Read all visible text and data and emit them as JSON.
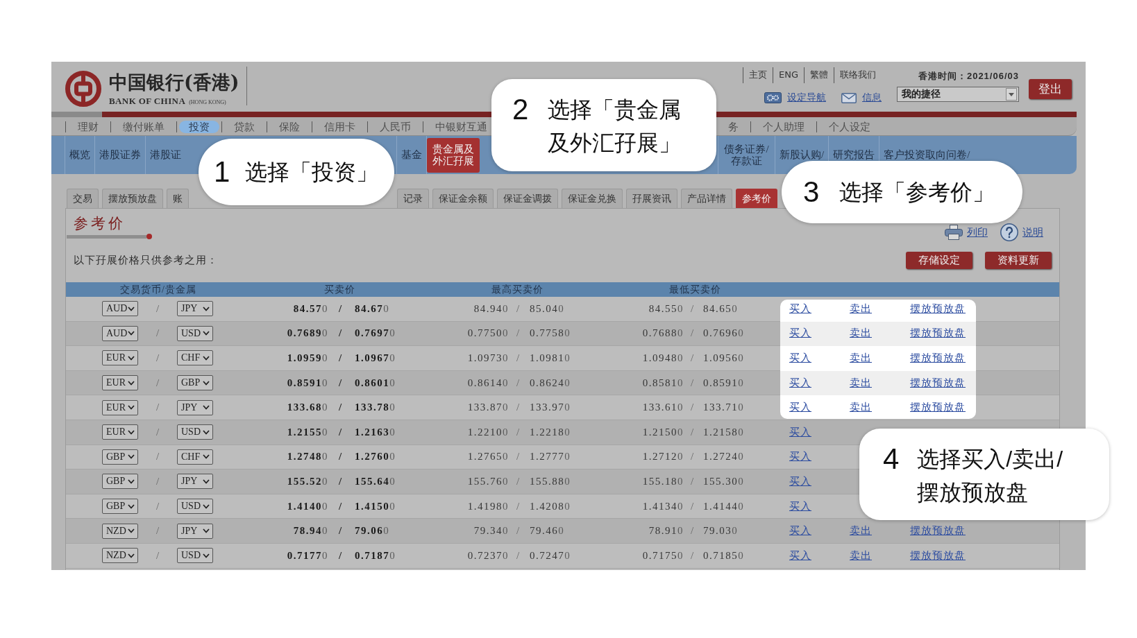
{
  "header": {
    "logo": {
      "name_zh": "中国银行(香港)",
      "name_en": "BANK OF CHINA",
      "region_en": "(HONG KONG)"
    },
    "top_links": [
      "主页",
      "ENG",
      "繁體",
      "联络我们"
    ],
    "time": "香港时间：2021/06/03",
    "logout_button": "登出",
    "tools": [
      {
        "kind": "settings",
        "label": "设定导航"
      },
      {
        "kind": "mail",
        "label": "信息"
      }
    ],
    "shortcut_dropdown": {
      "value": "我的捷径"
    }
  },
  "main_nav": [
    {
      "label": "理财",
      "selected": false
    },
    {
      "label": "缴付账单",
      "selected": false
    },
    {
      "label": "投资",
      "selected": true
    },
    {
      "label": "贷款",
      "selected": false
    },
    {
      "label": "保险",
      "selected": false
    },
    {
      "label": "信用卡",
      "selected": false
    },
    {
      "label": "人民币",
      "selected": false
    },
    {
      "label": "中银财互通",
      "selected": false
    },
    {
      "label": "务",
      "selected": false
    },
    {
      "label": "个人助理",
      "selected": false
    },
    {
      "label": "个人设定",
      "selected": false
    }
  ],
  "sub_nav": [
    {
      "label": "概览",
      "selected": false
    },
    {
      "label": "港股证券",
      "selected": false
    },
    {
      "label": "港股证",
      "selected": false
    },
    {
      "label": "基金",
      "selected": false
    },
    {
      "label": "贵金属及外汇孖展",
      "selected": true
    },
    {
      "label": "债务证券/存款证",
      "selected": false
    },
    {
      "label": "新股认购/",
      "selected": false
    },
    {
      "label": "研究报告",
      "selected": false
    },
    {
      "label": "客户投资取向问卷/",
      "selected": false
    }
  ],
  "tabs": [
    {
      "label": "交易",
      "selected": false
    },
    {
      "label": "摆放预放盘",
      "selected": false
    },
    {
      "label": "账",
      "selected": false
    },
    {
      "label": "记录",
      "selected": false
    },
    {
      "label": "保证金余额",
      "selected": false
    },
    {
      "label": "保证金调拨",
      "selected": false
    },
    {
      "label": "保证金兑换",
      "selected": false
    },
    {
      "label": "孖展资讯",
      "selected": false
    },
    {
      "label": "产品详情",
      "selected": false
    },
    {
      "label": "参考价",
      "selected": true
    }
  ],
  "content": {
    "title": "参考价",
    "note": "以下孖展价格只供参考之用：",
    "links": [
      {
        "kind": "print",
        "label": "列印"
      },
      {
        "kind": "help",
        "label": "说明"
      }
    ],
    "buttons": [
      "存储设定",
      "资料更新"
    ]
  },
  "table": {
    "columns": [
      "交易货币/贵金属",
      "买卖价",
      "最高买卖价",
      "最低买卖价"
    ],
    "rows": [
      {
        "pair": {
          "base": "AUD",
          "separator": "/",
          "quote": "JPY"
        },
        "bid_ask": {
          "bid": "84.570",
          "separator": "/",
          "ask": "84.670"
        },
        "high": {
          "bid": "84.940",
          "separator": "/",
          "ask": "85.040"
        },
        "low": {
          "bid": "84.550",
          "separator": "/",
          "ask": "84.650"
        },
        "actions": [
          "买入",
          "卖出",
          "摆放预放盘"
        ],
        "highlighted": true
      },
      {
        "pair": {
          "base": "AUD",
          "separator": "/",
          "quote": "USD"
        },
        "bid_ask": {
          "bid": "0.76890",
          "separator": "/",
          "ask": "0.76970"
        },
        "high": {
          "bid": "0.77500",
          "separator": "/",
          "ask": "0.77580"
        },
        "low": {
          "bid": "0.76880",
          "separator": "/",
          "ask": "0.76960"
        },
        "actions": [
          "买入",
          "卖出",
          "摆放预放盘"
        ],
        "highlighted": true
      },
      {
        "pair": {
          "base": "EUR",
          "separator": "/",
          "quote": "CHF"
        },
        "bid_ask": {
          "bid": "1.09590",
          "separator": "/",
          "ask": "1.09670"
        },
        "high": {
          "bid": "1.09730",
          "separator": "/",
          "ask": "1.09810"
        },
        "low": {
          "bid": "1.09480",
          "separator": "/",
          "ask": "1.09560"
        },
        "actions": [
          "买入",
          "卖出",
          "摆放预放盘"
        ],
        "highlighted": true
      },
      {
        "pair": {
          "base": "EUR",
          "separator": "/",
          "quote": "GBP"
        },
        "bid_ask": {
          "bid": "0.85910",
          "separator": "/",
          "ask": "0.86010"
        },
        "high": {
          "bid": "0.86140",
          "separator": "/",
          "ask": "0.86240"
        },
        "low": {
          "bid": "0.85810",
          "separator": "/",
          "ask": "0.85910"
        },
        "actions": [
          "买入",
          "卖出",
          "摆放预放盘"
        ],
        "highlighted": true
      },
      {
        "pair": {
          "base": "EUR",
          "separator": "/",
          "quote": "JPY"
        },
        "bid_ask": {
          "bid": "133.680",
          "separator": "/",
          "ask": "133.780"
        },
        "high": {
          "bid": "133.870",
          "separator": "/",
          "ask": "133.970"
        },
        "low": {
          "bid": "133.610",
          "separator": "/",
          "ask": "133.710"
        },
        "actions": [
          "买入",
          "卖出",
          "摆放预放盘"
        ],
        "highlighted": true
      },
      {
        "pair": {
          "base": "EUR",
          "separator": "/",
          "quote": "USD"
        },
        "bid_ask": {
          "bid": "1.21550",
          "separator": "/",
          "ask": "1.21630"
        },
        "high": {
          "bid": "1.22100",
          "separator": "/",
          "ask": "1.22180"
        },
        "low": {
          "bid": "1.21500",
          "separator": "/",
          "ask": "1.21580"
        },
        "actions": [
          "买入"
        ],
        "highlighted": false
      },
      {
        "pair": {
          "base": "GBP",
          "separator": "/",
          "quote": "CHF"
        },
        "bid_ask": {
          "bid": "1.27480",
          "separator": "/",
          "ask": "1.27600"
        },
        "high": {
          "bid": "1.27650",
          "separator": "/",
          "ask": "1.27770"
        },
        "low": {
          "bid": "1.27120",
          "separator": "/",
          "ask": "1.27240"
        },
        "actions": [
          "买入"
        ],
        "highlighted": false
      },
      {
        "pair": {
          "base": "GBP",
          "separator": "/",
          "quote": "JPY"
        },
        "bid_ask": {
          "bid": "155.520",
          "separator": "/",
          "ask": "155.640"
        },
        "high": {
          "bid": "155.760",
          "separator": "/",
          "ask": "155.880"
        },
        "low": {
          "bid": "155.180",
          "separator": "/",
          "ask": "155.300"
        },
        "actions": [
          "买入"
        ],
        "highlighted": false
      },
      {
        "pair": {
          "base": "GBP",
          "separator": "/",
          "quote": "USD"
        },
        "bid_ask": {
          "bid": "1.41400",
          "separator": "/",
          "ask": "1.41500"
        },
        "high": {
          "bid": "1.41980",
          "separator": "/",
          "ask": "1.42080"
        },
        "low": {
          "bid": "1.41340",
          "separator": "/",
          "ask": "1.41440"
        },
        "actions": [
          "买入"
        ],
        "highlighted": false
      },
      {
        "pair": {
          "base": "NZD",
          "separator": "/",
          "quote": "JPY"
        },
        "bid_ask": {
          "bid": "78.940",
          "separator": "/",
          "ask": "79.060"
        },
        "high": {
          "bid": "79.340",
          "separator": "/",
          "ask": "79.460"
        },
        "low": {
          "bid": "78.910",
          "separator": "/",
          "ask": "79.030"
        },
        "actions": [
          "买入",
          "卖出",
          "摆放预放盘"
        ],
        "highlighted": false
      },
      {
        "pair": {
          "base": "NZD",
          "separator": "/",
          "quote": "USD"
        },
        "bid_ask": {
          "bid": "0.71770",
          "separator": "/",
          "ask": "0.71870"
        },
        "high": {
          "bid": "0.72370",
          "separator": "/",
          "ask": "0.72470"
        },
        "low": {
          "bid": "0.71750",
          "separator": "/",
          "ask": "0.71850"
        },
        "actions": [
          "买入",
          "卖出",
          "摆放预放盘"
        ],
        "highlighted": false
      }
    ]
  },
  "callouts": [
    {
      "number": "1",
      "text": "选择「投资」"
    },
    {
      "number": "2",
      "text": "选择「贵金属及外汇孖展」"
    },
    {
      "number": "3",
      "text": "选择「参考价」"
    },
    {
      "number": "4",
      "text": "选择买入/卖出/摆放预放盘"
    }
  ]
}
